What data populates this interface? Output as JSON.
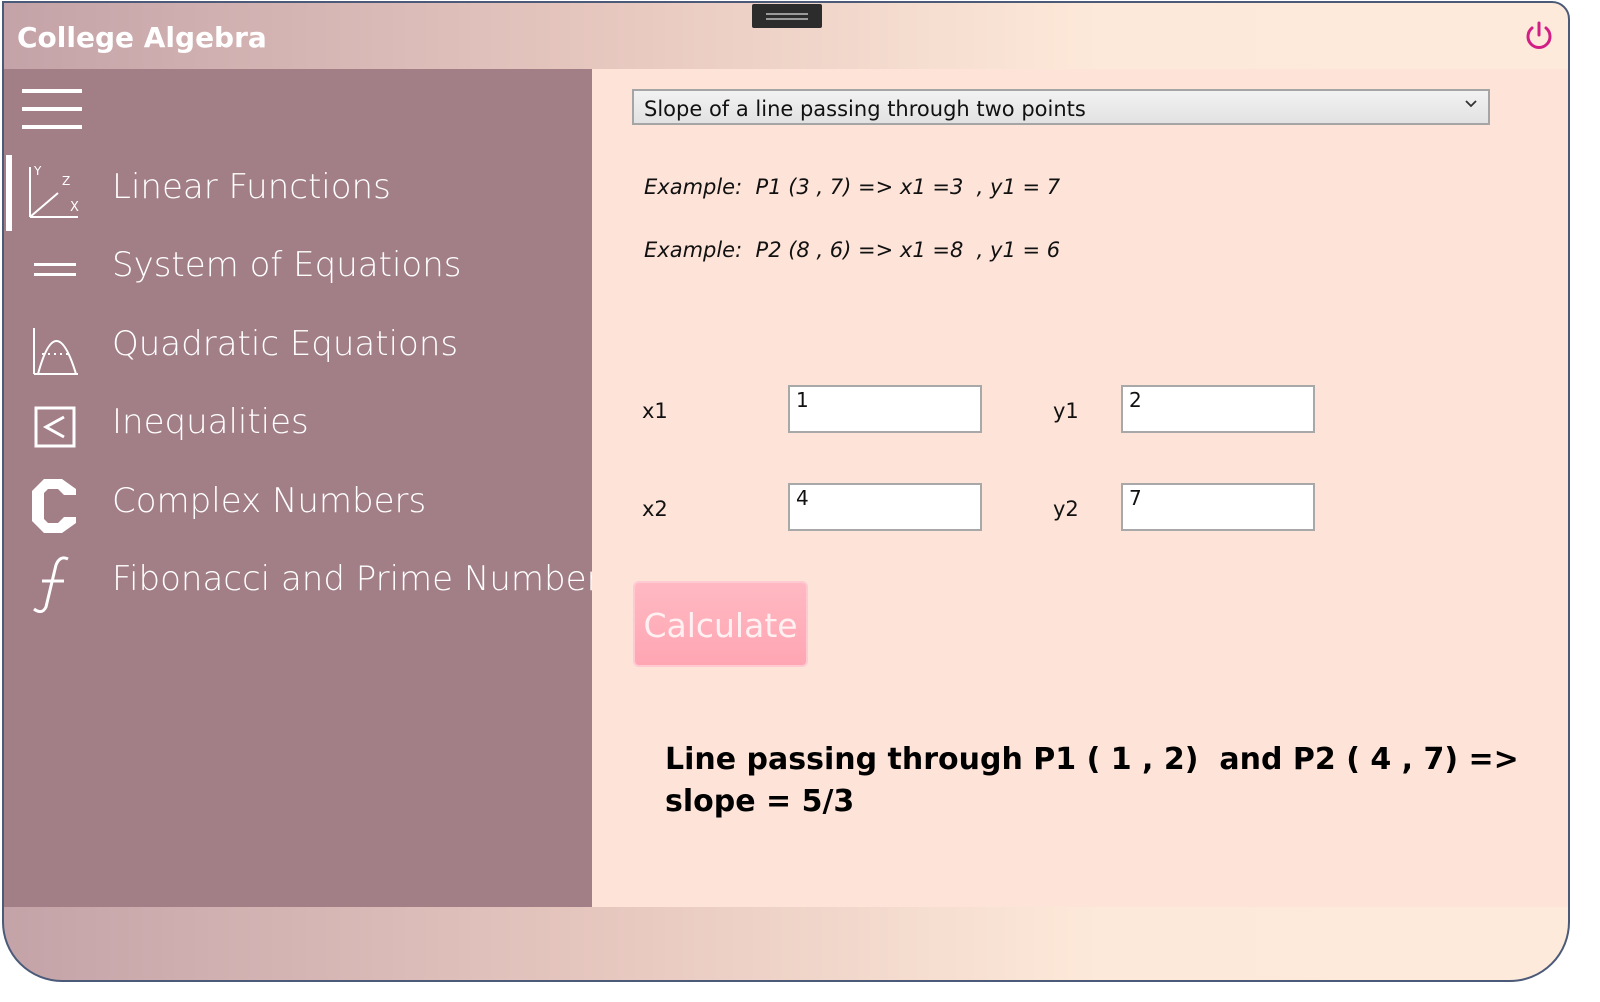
{
  "app": {
    "title": "College Algebra"
  },
  "icons": {
    "power": "power-icon",
    "menu": "hamburger-menu-icon",
    "dropdown": "chevron-down-icon"
  },
  "colors": {
    "sidebar": "#a27e87",
    "content": "#fde3d8",
    "power_accent": "#d11f85",
    "button": "#ffa6b3"
  },
  "sidebar": {
    "selected_index": 0,
    "items": [
      {
        "label": "Linear Functions",
        "icon": "axes-xyz-icon"
      },
      {
        "label": "System of Equations",
        "icon": "equals-icon"
      },
      {
        "label": "Quadratic Equations",
        "icon": "parabola-icon"
      },
      {
        "label": "Inequalities",
        "icon": "less-than-box-icon"
      },
      {
        "label": "Complex Numbers",
        "icon": "letter-c-icon"
      },
      {
        "label": "Fibonacci and Prime Numbers",
        "icon": "function-f-icon"
      }
    ]
  },
  "main": {
    "calculation_type": "Slope of a line passing through two points",
    "examples": [
      "Example:  P1 (3 , 7) => x1 =3  , y1 = 7",
      "Example:  P2 (8 , 6) => x1 =8  , y1 = 6"
    ],
    "fields": {
      "x1": {
        "label": "x1",
        "value": "1"
      },
      "y1": {
        "label": "y1",
        "value": "2"
      },
      "x2": {
        "label": "x2",
        "value": "4"
      },
      "y2": {
        "label": "y2",
        "value": "7"
      }
    },
    "calculate_label": "Calculate",
    "result": "Line passing through P1 ( 1 , 2)  and P2 ( 4 , 7) => slope = 5/3"
  }
}
